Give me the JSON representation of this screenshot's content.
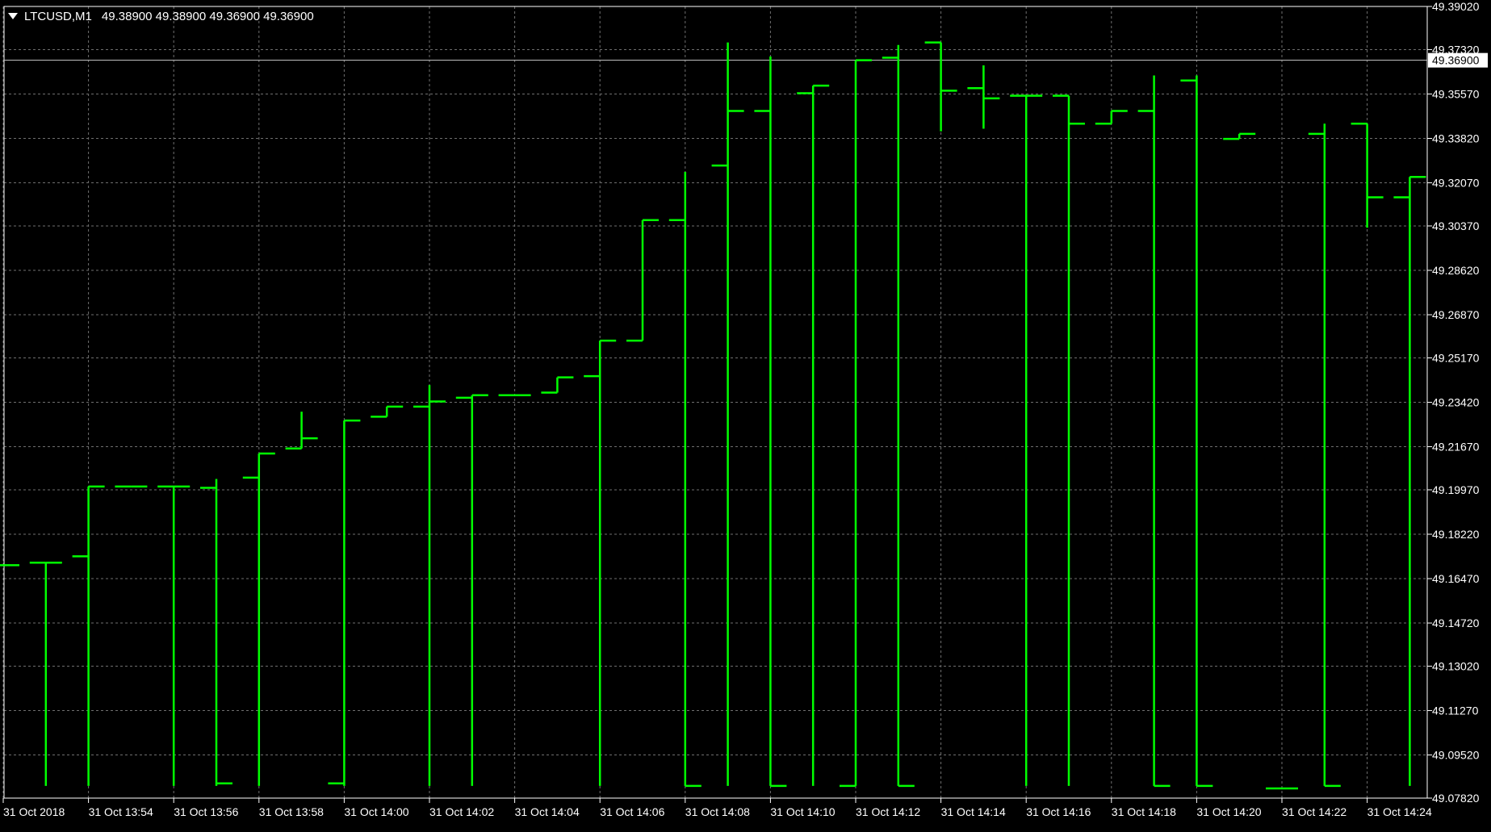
{
  "window": {
    "symbol_label": "LTCUSD,M1",
    "ohlc_label": "49.38900 49.38900 49.36900 49.36900",
    "current_price_label": "49.36900"
  },
  "colors": {
    "background": "#000000",
    "grid": "#6f6f6f",
    "axis": "#ffffff",
    "text": "#ffffff",
    "bars": "#00ff00",
    "price_line": "#c9c9c9",
    "price_label_bg": "#ffffff",
    "price_label_text": "#000000"
  },
  "icons": {
    "collapse_indicator": "triangle-down-icon"
  },
  "chart_data": {
    "type": "ohlc",
    "symbol": "LTCUSD",
    "timeframe": "M1",
    "title": "",
    "xlabel": "",
    "ylabel": "",
    "ylim": [
      49.0782,
      49.3902
    ],
    "grid": true,
    "legend": "none",
    "current_price": 49.369,
    "y_ticks": [
      "49.39020",
      "49.37320",
      "49.35570",
      "49.33820",
      "49.32070",
      "49.30370",
      "49.28620",
      "49.26870",
      "49.25170",
      "49.23420",
      "49.21670",
      "49.19970",
      "49.18220",
      "49.16470",
      "49.14720",
      "49.13020",
      "49.11270",
      "49.09520",
      "49.07820"
    ],
    "x_ticks": [
      {
        "label": "31 Oct 2018",
        "bar": 0
      },
      {
        "label": "31 Oct 13:54",
        "bar": 2
      },
      {
        "label": "31 Oct 13:56",
        "bar": 4
      },
      {
        "label": "31 Oct 13:58",
        "bar": 6
      },
      {
        "label": "31 Oct 14:00",
        "bar": 8
      },
      {
        "label": "31 Oct 14:02",
        "bar": 10
      },
      {
        "label": "31 Oct 14:04",
        "bar": 12
      },
      {
        "label": "31 Oct 14:06",
        "bar": 14
      },
      {
        "label": "31 Oct 14:08",
        "bar": 16
      },
      {
        "label": "31 Oct 14:10",
        "bar": 18
      },
      {
        "label": "31 Oct 14:12",
        "bar": 20
      },
      {
        "label": "31 Oct 14:14",
        "bar": 22
      },
      {
        "label": "31 Oct 14:16",
        "bar": 24
      },
      {
        "label": "31 Oct 14:18",
        "bar": 26
      },
      {
        "label": "31 Oct 14:20",
        "bar": 28
      },
      {
        "label": "31 Oct 14:22",
        "bar": 30
      },
      {
        "label": "31 Oct 14:24",
        "bar": 32
      }
    ],
    "bars": [
      {
        "o": 49.17,
        "h": 49.17,
        "l": 49.17,
        "c": 49.17
      },
      {
        "o": 49.171,
        "h": 49.171,
        "l": 49.083,
        "c": 49.171
      },
      {
        "o": 49.1735,
        "h": 49.201,
        "l": 49.083,
        "c": 49.201
      },
      {
        "o": 49.201,
        "h": 49.201,
        "l": 49.201,
        "c": 49.201
      },
      {
        "o": 49.201,
        "h": 49.201,
        "l": 49.083,
        "c": 49.201
      },
      {
        "o": 49.2005,
        "h": 49.204,
        "l": 49.083,
        "c": 49.084
      },
      {
        "o": 49.2045,
        "h": 49.214,
        "l": 49.083,
        "c": 49.214
      },
      {
        "o": 49.216,
        "h": 49.2305,
        "l": 49.216,
        "c": 49.22
      },
      {
        "o": 49.084,
        "h": 49.227,
        "l": 49.083,
        "c": 49.227
      },
      {
        "o": 49.2285,
        "h": 49.2325,
        "l": 49.2285,
        "c": 49.2325
      },
      {
        "o": 49.2325,
        "h": 49.241,
        "l": 49.083,
        "c": 49.2345
      },
      {
        "o": 49.236,
        "h": 49.237,
        "l": 49.083,
        "c": 49.237
      },
      {
        "o": 49.237,
        "h": 49.237,
        "l": 49.237,
        "c": 49.237
      },
      {
        "o": 49.238,
        "h": 49.244,
        "l": 49.238,
        "c": 49.244
      },
      {
        "o": 49.2445,
        "h": 49.2585,
        "l": 49.083,
        "c": 49.2585
      },
      {
        "o": 49.2585,
        "h": 49.306,
        "l": 49.2585,
        "c": 49.306
      },
      {
        "o": 49.306,
        "h": 49.325,
        "l": 49.083,
        "c": 49.083
      },
      {
        "o": 49.3275,
        "h": 49.376,
        "l": 49.083,
        "c": 49.349
      },
      {
        "o": 49.349,
        "h": 49.3705,
        "l": 49.083,
        "c": 49.083
      },
      {
        "o": 49.356,
        "h": 49.359,
        "l": 49.083,
        "c": 49.359
      },
      {
        "o": 49.083,
        "h": 49.369,
        "l": 49.083,
        "c": 49.369
      },
      {
        "o": 49.37,
        "h": 49.375,
        "l": 49.083,
        "c": 49.083
      },
      {
        "o": 49.376,
        "h": 49.376,
        "l": 49.341,
        "c": 49.357
      },
      {
        "o": 49.358,
        "h": 49.367,
        "l": 49.342,
        "c": 49.354
      },
      {
        "o": 49.355,
        "h": 49.355,
        "l": 49.083,
        "c": 49.355
      },
      {
        "o": 49.355,
        "h": 49.355,
        "l": 49.083,
        "c": 49.344
      },
      {
        "o": 49.344,
        "h": 49.349,
        "l": 49.344,
        "c": 49.349
      },
      {
        "o": 49.349,
        "h": 49.363,
        "l": 49.083,
        "c": 49.083
      },
      {
        "o": 49.361,
        "h": 49.363,
        "l": 49.083,
        "c": 49.083
      },
      {
        "o": 49.338,
        "h": 49.34,
        "l": 49.338,
        "c": 49.34
      },
      {
        "o": 49.082,
        "h": 49.082,
        "l": 49.082,
        "c": 49.082
      },
      {
        "o": 49.34,
        "h": 49.344,
        "l": 49.083,
        "c": 49.083
      },
      {
        "o": 49.344,
        "h": 49.344,
        "l": 49.303,
        "c": 49.315
      },
      {
        "o": 49.315,
        "h": 49.323,
        "l": 49.083,
        "c": 49.323
      }
    ]
  }
}
